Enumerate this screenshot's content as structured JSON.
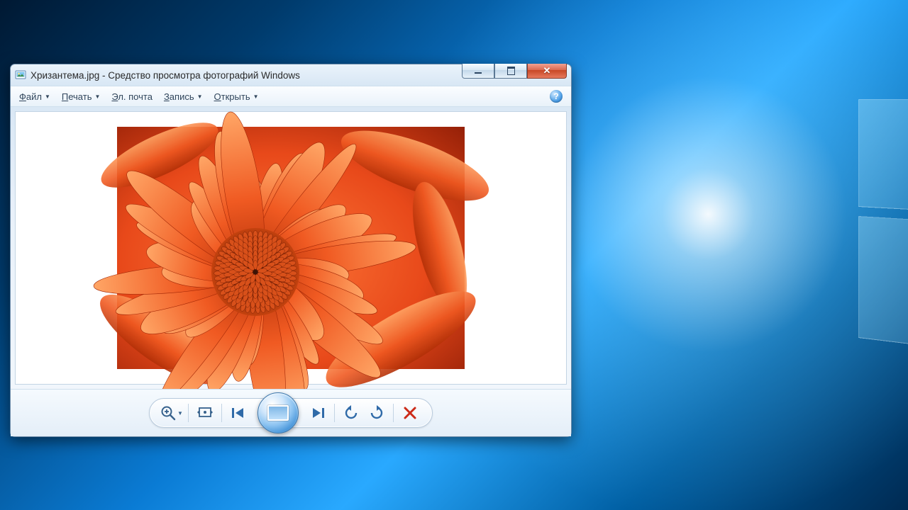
{
  "window": {
    "title": "Хризантема.jpg - Средство просмотра фотографий Windows",
    "app_icon": "photo-viewer-icon"
  },
  "window_controls": {
    "minimize": "minimize",
    "maximize": "maximize",
    "close": "close"
  },
  "menu": {
    "file": {
      "label_u": "Ф",
      "label_rest": "айл",
      "has_dropdown": true
    },
    "print": {
      "label_u": "П",
      "label_rest": "ечать",
      "has_dropdown": true
    },
    "email": {
      "label_u": "Э",
      "label_rest": "л. почта",
      "has_dropdown": false
    },
    "burn": {
      "label_u": "З",
      "label_rest": "апись",
      "has_dropdown": true
    },
    "open": {
      "label_u": "О",
      "label_rest": "ткрыть",
      "has_dropdown": true
    },
    "help_tooltip": "?"
  },
  "image": {
    "filename": "Хризантема.jpg",
    "description": "close-up of orange chrysanthemum flower"
  },
  "controls": {
    "zoom": "zoom-in",
    "fit": "fit-to-window",
    "prev": "previous",
    "slideshow": "slideshow",
    "next": "next",
    "rotate_ccw": "rotate-counterclockwise",
    "rotate_cw": "rotate-clockwise",
    "delete": "delete"
  },
  "colors": {
    "accent": "#3e8fd6",
    "close": "#c84725"
  }
}
